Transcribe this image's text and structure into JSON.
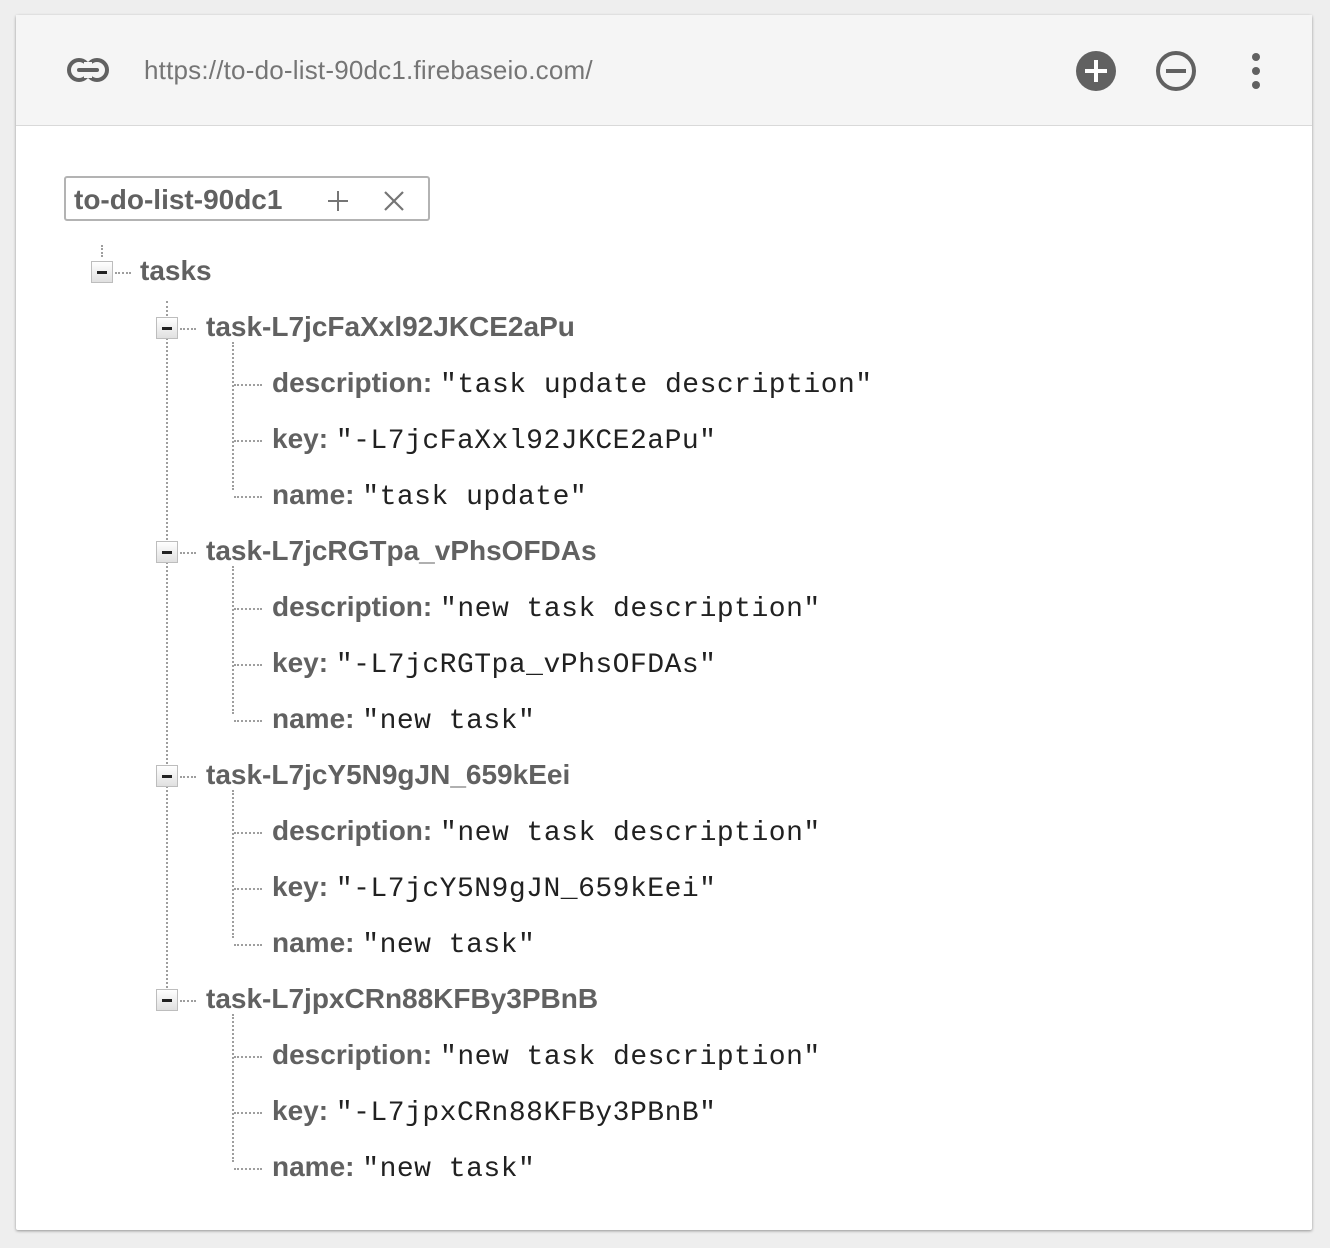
{
  "toolbar": {
    "url": "https://to-do-list-90dc1.firebaseio.com/",
    "icons": [
      "link-icon",
      "add-circle-icon",
      "remove-circle-icon",
      "more-vert-icon"
    ]
  },
  "root": {
    "label": "to-do-list-90dc1",
    "add_glyph": "+",
    "delete_glyph": "×"
  },
  "tree": {
    "tasks_label": "tasks",
    "tasks": [
      {
        "name": "task-L7jcFaXxl92JKCE2aPu",
        "fields": [
          {
            "key": "description",
            "value": "\"task update description\""
          },
          {
            "key": "key",
            "value": "\"-L7jcFaXxl92JKCE2aPu\""
          },
          {
            "key": "name",
            "value": "\"task update\""
          }
        ]
      },
      {
        "name": "task-L7jcRGTpa_vPhsOFDAs",
        "fields": [
          {
            "key": "description",
            "value": "\"new task description\""
          },
          {
            "key": "key",
            "value": "\"-L7jcRGTpa_vPhsOFDAs\""
          },
          {
            "key": "name",
            "value": "\"new task\""
          }
        ]
      },
      {
        "name": "task-L7jcY5N9gJN_659kEei",
        "fields": [
          {
            "key": "description",
            "value": "\"new task description\""
          },
          {
            "key": "key",
            "value": "\"-L7jcY5N9gJN_659kEei\""
          },
          {
            "key": "name",
            "value": "\"new task\""
          }
        ]
      },
      {
        "name": "task-L7jpxCRn88KFBy3PBnB",
        "fields": [
          {
            "key": "description",
            "value": "\"new task description\""
          },
          {
            "key": "key",
            "value": "\"-L7jpxCRn88KFBy3PBnB\""
          },
          {
            "key": "name",
            "value": "\"new task\""
          }
        ]
      }
    ]
  }
}
